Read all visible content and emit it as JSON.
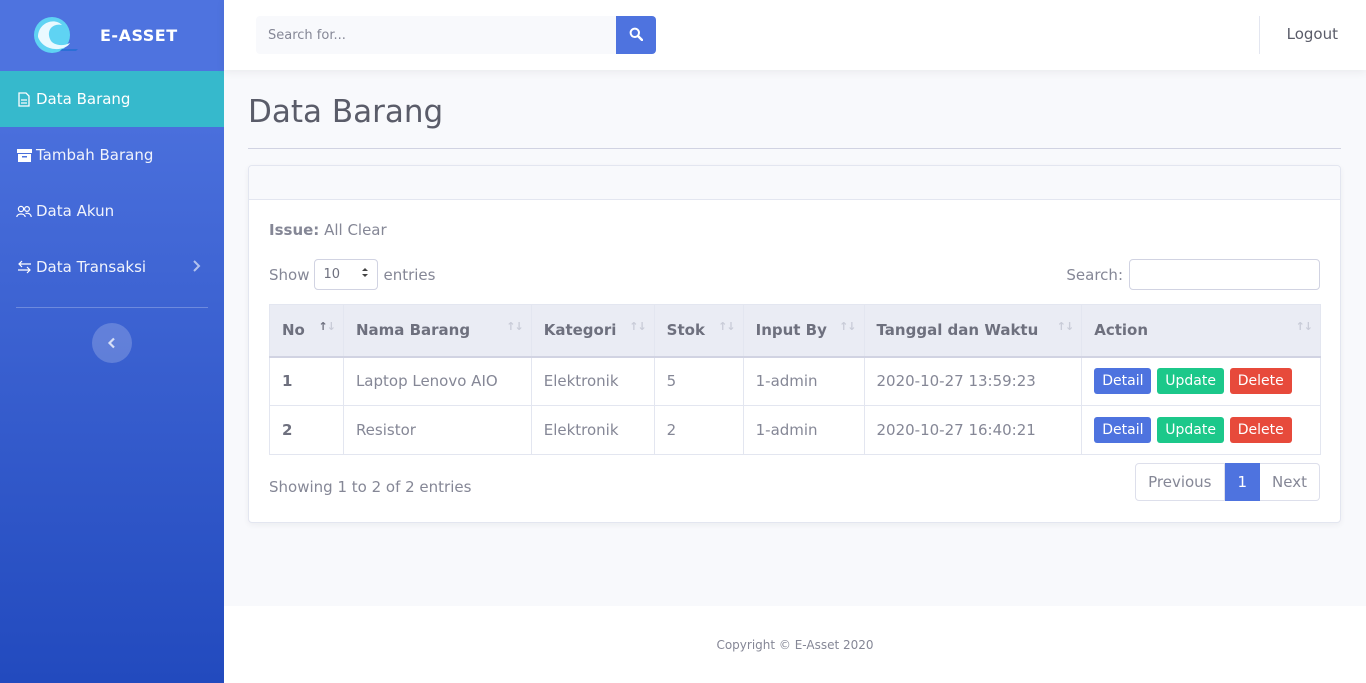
{
  "brand": {
    "name": "E-ASSET"
  },
  "sidebar": {
    "items": [
      {
        "label": "Data Barang",
        "icon": "file-icon",
        "active": true
      },
      {
        "label": "Tambah Barang",
        "icon": "archive-icon",
        "active": false
      },
      {
        "label": "Data Akun",
        "icon": "users-icon",
        "active": false
      },
      {
        "label": "Data Transaksi",
        "icon": "exchange-icon",
        "active": false
      }
    ]
  },
  "topbar": {
    "search_placeholder": "Search for...",
    "logout_label": "Logout"
  },
  "page": {
    "title": "Data Barang"
  },
  "issue": {
    "label": "Issue:",
    "value": "All Clear"
  },
  "table_controls": {
    "show_label": "Show",
    "length_value": "10",
    "entries_label": "entries",
    "search_label": "Search:"
  },
  "table": {
    "columns": [
      "No",
      "Nama Barang",
      "Kategori",
      "Stok",
      "Input By",
      "Tanggal dan Waktu",
      "Action"
    ],
    "rows": [
      {
        "no": "1",
        "nama": "Laptop Lenovo AIO",
        "kategori": "Elektronik",
        "stok": "5",
        "input_by": "1-admin",
        "tanggal": "2020-10-27 13:59:23"
      },
      {
        "no": "2",
        "nama": "Resistor",
        "kategori": "Elektronik",
        "stok": "2",
        "input_by": "1-admin",
        "tanggal": "2020-10-27 16:40:21"
      }
    ],
    "actions": {
      "detail": "Detail",
      "update": "Update",
      "delete": "Delete"
    }
  },
  "pagination": {
    "info": "Showing 1 to 2 of 2 entries",
    "previous": "Previous",
    "current": "1",
    "next": "Next"
  },
  "footer": {
    "text": "Copyright © E-Asset 2020"
  },
  "colors": {
    "primary": "#4e73df",
    "info": "#36b9cc",
    "success": "#1cc88a",
    "danger": "#e74a3b"
  }
}
